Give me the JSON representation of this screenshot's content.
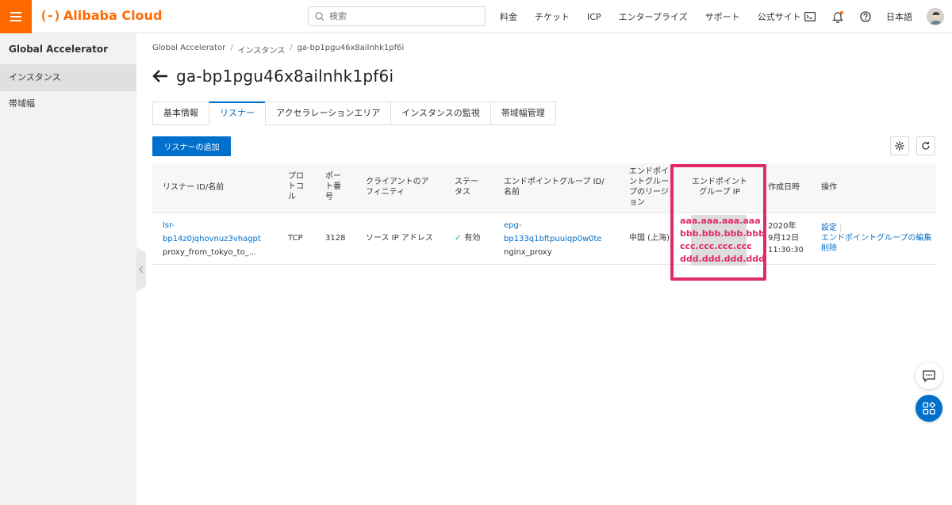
{
  "topbar": {
    "brand": "Alibaba Cloud",
    "brand_mark": "(-)",
    "search_placeholder": "検索",
    "nav": [
      "料金",
      "チケット",
      "ICP",
      "エンタープライズ",
      "サポート",
      "公式サイト"
    ],
    "language": "日本語"
  },
  "sidebar": {
    "title": "Global Accelerator",
    "items": [
      {
        "label": "インスタンス"
      },
      {
        "label": "帯域幅"
      }
    ]
  },
  "breadcrumb": [
    "Global Accelerator",
    "インスタンス",
    "ga-bp1pgu46x8ailnhk1pf6i"
  ],
  "page": {
    "title": "ga-bp1pgu46x8ailnhk1pf6i"
  },
  "tabs": [
    "基本情報",
    "リスナー",
    "アクセラレーションエリア",
    "インスタンスの監視",
    "帯域幅管理"
  ],
  "toolbar": {
    "add_listener": "リスナーの追加"
  },
  "table": {
    "headers": {
      "listener": "リスナー ID/名前",
      "protocol": "プロ\nトコ\nル",
      "port": "ポー\nト番\n号",
      "affinity": "クライアントのア\nフィニティ",
      "status": "ステー\nタス",
      "epg": "エンドポイントグループ ID/\n名前",
      "region": "エンドポイ\nントグルー\nプのリージ\nョン",
      "epg_ip": "エンドポイント\nグループ IP",
      "created": "作成日時",
      "actions": "操作"
    },
    "rows": [
      {
        "listener_id_line1": "lsr-",
        "listener_id_line2": "bp14z0jqhovnuz3vhagpt",
        "listener_name": "proxy_from_tokyo_to_...",
        "protocol": "TCP",
        "port": "3128",
        "affinity": "ソース IP アドレス",
        "status": "有効",
        "epg_id_line1": "epg-",
        "epg_id_line2": "bp133q1bftpuuiqp0w0te",
        "epg_name": "nginx_proxy",
        "region": "中国 (上海)",
        "ips": [
          "aaa.aaa.aaa.aaa",
          "bbb.bbb.bbb.bbb",
          "ccc.ccc.ccc.ccc",
          "ddd.ddd.ddd.ddd"
        ],
        "created_line1": "2020年",
        "created_line2": "9月12日",
        "created_line3": "11:30:30",
        "actions": [
          "設定",
          "エンドポイントグループの編集",
          "削除"
        ]
      }
    ]
  },
  "colors": {
    "brand": "#ff6a00",
    "primary": "#0070cc",
    "highlight": "#e02a6b"
  }
}
